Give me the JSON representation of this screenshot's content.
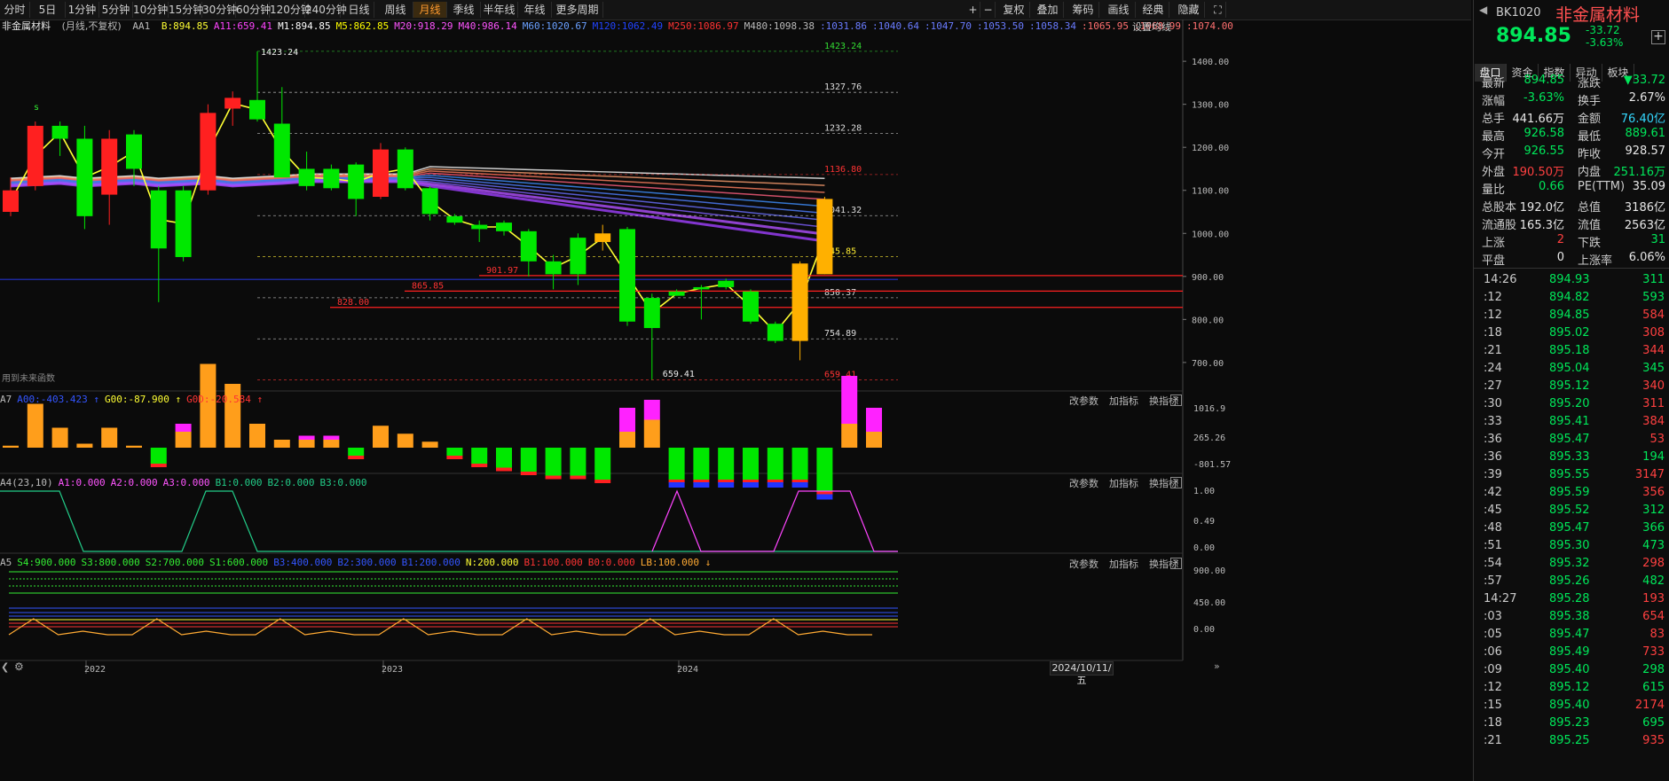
{
  "toolbar": {
    "periods": [
      "分时",
      "5日",
      "1分钟",
      "5分钟",
      "10分钟",
      "15分钟",
      "30分钟",
      "60分钟",
      "120分钟",
      "240分钟",
      "日线",
      "周线",
      "月线",
      "季线",
      "半年线",
      "年线",
      "更多周期"
    ],
    "active_period": "月线",
    "right_buttons": [
      "复权",
      "叠加",
      "筹码",
      "画线",
      "经典",
      "隐藏"
    ]
  },
  "main_legend": {
    "name": "非金属材料",
    "mode": "(月线,不复权)",
    "aa1": "AA1",
    "items": [
      {
        "label": "B:894.85",
        "color": "#ffff33"
      },
      {
        "label": "A11:659.41",
        "color": "#ff44ff"
      },
      {
        "label": "M1:894.85",
        "color": "#ffffff"
      },
      {
        "label": "M5:862.85",
        "color": "#ffff00"
      },
      {
        "label": "M20:918.29",
        "color": "#ff55ff"
      },
      {
        "label": "M40:986.14",
        "color": "#ff55ff"
      },
      {
        "label": "M60:1020.67",
        "color": "#6aa0ff"
      },
      {
        "label": "M120:1062.49",
        "color": "#2244ff"
      },
      {
        "label": "M250:1086.97",
        "color": "#ff3333"
      },
      {
        "label": "M480:1098.38",
        "color": "#bbbbbb"
      },
      {
        "label": ":1031.86",
        "color": "#6a7cff"
      },
      {
        "label": ":1040.64",
        "color": "#6a7cff"
      },
      {
        "label": ":1047.70",
        "color": "#6a7cff"
      },
      {
        "label": ":1053.50",
        "color": "#6a7cff"
      },
      {
        "label": ":1058.34",
        "color": "#6a7cff"
      },
      {
        "label": ":1065.95",
        "color": "#ff7070"
      },
      {
        "label": ":1068.99",
        "color": "#ff7070"
      },
      {
        "label": ":1074.00",
        "color": "#ff7070"
      }
    ],
    "settings": "设置均线"
  },
  "future_note": "用到未来函数",
  "main_axis_labels": [
    "1400.00",
    "1300.00",
    "1200.00",
    "1100.00",
    "1000.00",
    "900.00",
    "800.00",
    "700.00"
  ],
  "chart_annotations": {
    "high_label": "1423.24",
    "low_label": "659.41",
    "levels": [
      {
        "label": "1423.24",
        "color": "#33dd33"
      },
      {
        "label": "1327.76",
        "color": "#dddddd"
      },
      {
        "label": "1232.28",
        "color": "#dddddd"
      },
      {
        "label": "1136.80",
        "color": "#ff3333"
      },
      {
        "label": "1041.32",
        "color": "#dddddd"
      },
      {
        "label": "945.85",
        "color": "#ffee33"
      },
      {
        "label": "850.37",
        "color": "#dddddd"
      },
      {
        "label": "754.89",
        "color": "#dddddd"
      },
      {
        "label": "659.41",
        "color": "#ff3333"
      }
    ],
    "hlines": [
      "901.97",
      "865.85",
      "828.00"
    ],
    "signal_s": "s"
  },
  "chart_data": {
    "type": "candlestick",
    "period": "monthly",
    "x_ticks": [
      "2022",
      "2023",
      "2024"
    ],
    "date_label": "2024/10/11/五",
    "ylim": [
      640,
      1460
    ],
    "candles": [
      {
        "o": 1100,
        "h": 1130,
        "l": 1040,
        "c": 1050,
        "col": "red"
      },
      {
        "o": 1110,
        "h": 1260,
        "l": 1100,
        "c": 1250,
        "col": "red"
      },
      {
        "o": 1220,
        "h": 1260,
        "l": 1180,
        "c": 1250,
        "col": "green"
      },
      {
        "o": 1220,
        "h": 1250,
        "l": 1010,
        "c": 1040,
        "col": "green"
      },
      {
        "o": 1220,
        "h": 1240,
        "l": 1020,
        "c": 1090,
        "col": "red"
      },
      {
        "o": 1230,
        "h": 1240,
        "l": 1110,
        "c": 1150,
        "col": "green"
      },
      {
        "o": 1100,
        "h": 1110,
        "l": 840,
        "c": 965,
        "col": "green"
      },
      {
        "o": 1100,
        "h": 1110,
        "l": 935,
        "c": 945,
        "col": "green"
      },
      {
        "o": 1100,
        "h": 1300,
        "l": 1090,
        "c": 1280,
        "col": "red"
      },
      {
        "o": 1290,
        "h": 1330,
        "l": 1250,
        "c": 1315,
        "col": "red"
      },
      {
        "o": 1310,
        "h": 1423,
        "l": 1260,
        "c": 1265,
        "col": "green"
      },
      {
        "o": 1255,
        "h": 1340,
        "l": 1160,
        "c": 1130,
        "col": "green"
      },
      {
        "o": 1150,
        "h": 1190,
        "l": 1100,
        "c": 1110,
        "col": "green"
      },
      {
        "o": 1150,
        "h": 1160,
        "l": 1100,
        "c": 1105,
        "col": "green"
      },
      {
        "o": 1160,
        "h": 1165,
        "l": 1040,
        "c": 1080,
        "col": "green"
      },
      {
        "o": 1085,
        "h": 1210,
        "l": 1080,
        "c": 1195,
        "col": "red"
      },
      {
        "o": 1195,
        "h": 1200,
        "l": 1100,
        "c": 1105,
        "col": "green"
      },
      {
        "o": 1105,
        "h": 1110,
        "l": 1030,
        "c": 1045,
        "col": "green"
      },
      {
        "o": 1040,
        "h": 1045,
        "l": 1020,
        "c": 1025,
        "col": "green"
      },
      {
        "o": 1020,
        "h": 1030,
        "l": 980,
        "c": 1010,
        "col": "green"
      },
      {
        "o": 1025,
        "h": 1030,
        "l": 995,
        "c": 1005,
        "col": "green"
      },
      {
        "o": 1005,
        "h": 1010,
        "l": 900,
        "c": 935,
        "col": "green"
      },
      {
        "o": 935,
        "h": 950,
        "l": 870,
        "c": 905,
        "col": "green"
      },
      {
        "o": 905,
        "h": 1000,
        "l": 880,
        "c": 990,
        "col": "green"
      },
      {
        "o": 1000,
        "h": 1020,
        "l": 960,
        "c": 980,
        "col": "orange"
      },
      {
        "o": 1010,
        "h": 1015,
        "l": 785,
        "c": 795,
        "col": "green"
      },
      {
        "o": 850,
        "h": 860,
        "l": 660,
        "c": 780,
        "col": "green"
      },
      {
        "o": 865,
        "h": 870,
        "l": 855,
        "c": 855,
        "col": "green"
      },
      {
        "o": 875,
        "h": 880,
        "l": 800,
        "c": 870,
        "col": "green"
      },
      {
        "o": 890,
        "h": 895,
        "l": 870,
        "c": 875,
        "col": "green"
      },
      {
        "o": 865,
        "h": 870,
        "l": 790,
        "c": 795,
        "col": "green"
      },
      {
        "o": 790,
        "h": 795,
        "l": 745,
        "c": 750,
        "col": "green"
      },
      {
        "o": 930,
        "h": 935,
        "l": 705,
        "c": 750,
        "col": "orange"
      },
      {
        "o": 1080,
        "h": 1085,
        "l": 905,
        "c": 905,
        "col": "orange"
      }
    ]
  },
  "a7": {
    "name": "A7",
    "items": [
      {
        "label": "A00:-403.423 ↑",
        "color": "#3355ff"
      },
      {
        "label": "G00:-87.900 ↑",
        "color": "#ffff33"
      },
      {
        "label": "G0D:-20.584 ↑",
        "color": "#ff3333"
      }
    ],
    "axis": [
      "1016.9",
      "265.26",
      "-801.57"
    ],
    "bars": [
      5,
      110,
      50,
      10,
      50,
      5,
      -40,
      40,
      210,
      160,
      60,
      20,
      20,
      20,
      -20,
      55,
      35,
      15,
      -20,
      -40,
      -50,
      -60,
      -70,
      -70,
      -80,
      40,
      70,
      -80,
      -80,
      -80,
      -80,
      -80,
      -80,
      -110,
      60,
      40
    ],
    "extra_pos": [
      0,
      0,
      0,
      0,
      0,
      0,
      0,
      20,
      0,
      0,
      0,
      0,
      10,
      10,
      0,
      0,
      0,
      0,
      0,
      0,
      0,
      0,
      0,
      0,
      0,
      60,
      50,
      0,
      0,
      0,
      0,
      0,
      0,
      0,
      120,
      60
    ]
  },
  "a4": {
    "name": "A4(23,10)",
    "items": [
      {
        "label": "A1:0.000",
        "color": "#ff55ff"
      },
      {
        "label": "A2:0.000",
        "color": "#ff55ff"
      },
      {
        "label": "A3:0.000",
        "color": "#ff55ff"
      },
      {
        "label": "B1:0.000",
        "color": "#22cc88"
      },
      {
        "label": "B2:0.000",
        "color": "#22cc88"
      },
      {
        "label": "B3:0.000",
        "color": "#22cc88"
      }
    ],
    "axis": [
      "1.00",
      "0.49",
      "0.00"
    ]
  },
  "a5": {
    "name": "A5",
    "items": [
      {
        "label": "S4:900.000",
        "color": "#33ee33"
      },
      {
        "label": "S3:800.000",
        "color": "#33ee33"
      },
      {
        "label": "S2:700.000",
        "color": "#33ee33"
      },
      {
        "label": "S1:600.000",
        "color": "#33ee33"
      },
      {
        "label": "B3:400.000",
        "color": "#3355ff"
      },
      {
        "label": "B2:300.000",
        "color": "#3355ff"
      },
      {
        "label": "B1:200.000",
        "color": "#3355ff"
      },
      {
        "label": "N:200.000",
        "color": "#ffff33"
      },
      {
        "label": "B1:100.000",
        "color": "#ff3333"
      },
      {
        "label": "B0:0.000",
        "color": "#ff3333"
      },
      {
        "label": "LB:100.000 ↓",
        "color": "#ffaa33"
      }
    ],
    "axis": [
      "900.00",
      "450.00",
      "0.00"
    ]
  },
  "panel_buttons": [
    "改参数",
    "加指标",
    "换指标"
  ],
  "quote": {
    "code": "BK1020",
    "name": "非金属材料",
    "price": "894.85",
    "change": "-33.72",
    "change_pct": "-3.63%",
    "tabs": [
      "盘口",
      "资金",
      "指数",
      "异动",
      "板块"
    ],
    "rows": [
      {
        "k1": "最新",
        "v1": "894.85",
        "c1": "green",
        "k2": "涨跌",
        "v2": "▼33.72",
        "c2": "green"
      },
      {
        "k1": "涨幅",
        "v1": "-3.63%",
        "c1": "green",
        "k2": "换手",
        "v2": "2.67%",
        "c2": "white"
      },
      {
        "k1": "总手",
        "v1": "441.66万",
        "c1": "white",
        "k2": "金额",
        "v2": "76.40亿",
        "c2": "cyan"
      },
      {
        "k1": "最高",
        "v1": "926.58",
        "c1": "green",
        "k2": "最低",
        "v2": "889.61",
        "c2": "green"
      },
      {
        "k1": "今开",
        "v1": "926.55",
        "c1": "green",
        "k2": "昨收",
        "v2": "928.57",
        "c2": "white"
      },
      {
        "k1": "外盘",
        "v1": "190.50万",
        "c1": "red",
        "k2": "内盘",
        "v2": "251.16万",
        "c2": "green"
      },
      {
        "k1": "量比",
        "v1": "0.66",
        "c1": "green",
        "k2": "PE(TTM)",
        "v2": "35.09",
        "c2": "white"
      },
      {
        "k1": "总股本",
        "v1": "192.0亿",
        "c1": "white",
        "k2": "总值",
        "v2": "3186亿",
        "c2": "white"
      },
      {
        "k1": "流通股",
        "v1": "165.3亿",
        "c1": "white",
        "k2": "流值",
        "v2": "2563亿",
        "c2": "white"
      },
      {
        "k1": "上涨",
        "v1": "2",
        "c1": "red",
        "k2": "下跌",
        "v2": "31",
        "c2": "green"
      },
      {
        "k1": "平盘",
        "v1": "0",
        "c1": "white",
        "k2": "上涨率",
        "v2": "6.06%",
        "c2": "white"
      }
    ],
    "ticks": [
      {
        "t": "14:26",
        "p": "894.93",
        "v": "311",
        "c": "green"
      },
      {
        "t": ":12",
        "p": "894.82",
        "v": "593",
        "c": "green"
      },
      {
        "t": ":12",
        "p": "894.85",
        "v": "584",
        "c": "red"
      },
      {
        "t": ":18",
        "p": "895.02",
        "v": "308",
        "c": "red"
      },
      {
        "t": ":21",
        "p": "895.18",
        "v": "344",
        "c": "red"
      },
      {
        "t": ":24",
        "p": "895.04",
        "v": "345",
        "c": "green"
      },
      {
        "t": ":27",
        "p": "895.12",
        "v": "340",
        "c": "red"
      },
      {
        "t": ":30",
        "p": "895.20",
        "v": "311",
        "c": "red"
      },
      {
        "t": ":33",
        "p": "895.41",
        "v": "384",
        "c": "red"
      },
      {
        "t": ":36",
        "p": "895.47",
        "v": "53",
        "c": "red"
      },
      {
        "t": ":36",
        "p": "895.33",
        "v": "194",
        "c": "green"
      },
      {
        "t": ":39",
        "p": "895.55",
        "v": "3147",
        "c": "red"
      },
      {
        "t": ":42",
        "p": "895.59",
        "v": "356",
        "c": "red"
      },
      {
        "t": ":45",
        "p": "895.52",
        "v": "312",
        "c": "green"
      },
      {
        "t": ":48",
        "p": "895.47",
        "v": "366",
        "c": "green"
      },
      {
        "t": ":51",
        "p": "895.30",
        "v": "473",
        "c": "green"
      },
      {
        "t": ":54",
        "p": "895.32",
        "v": "298",
        "c": "red"
      },
      {
        "t": ":57",
        "p": "895.26",
        "v": "482",
        "c": "green"
      },
      {
        "t": "14:27",
        "p": "895.28",
        "v": "193",
        "c": "red"
      },
      {
        "t": ":03",
        "p": "895.38",
        "v": "654",
        "c": "red"
      },
      {
        "t": ":05",
        "p": "895.47",
        "v": "83",
        "c": "red"
      },
      {
        "t": ":06",
        "p": "895.49",
        "v": "733",
        "c": "red"
      },
      {
        "t": ":09",
        "p": "895.40",
        "v": "298",
        "c": "green"
      },
      {
        "t": ":12",
        "p": "895.12",
        "v": "615",
        "c": "green"
      },
      {
        "t": ":15",
        "p": "895.40",
        "v": "2174",
        "c": "red"
      },
      {
        "t": ":18",
        "p": "895.23",
        "v": "695",
        "c": "green"
      },
      {
        "t": ":21",
        "p": "895.25",
        "v": "935",
        "c": "red"
      }
    ]
  }
}
